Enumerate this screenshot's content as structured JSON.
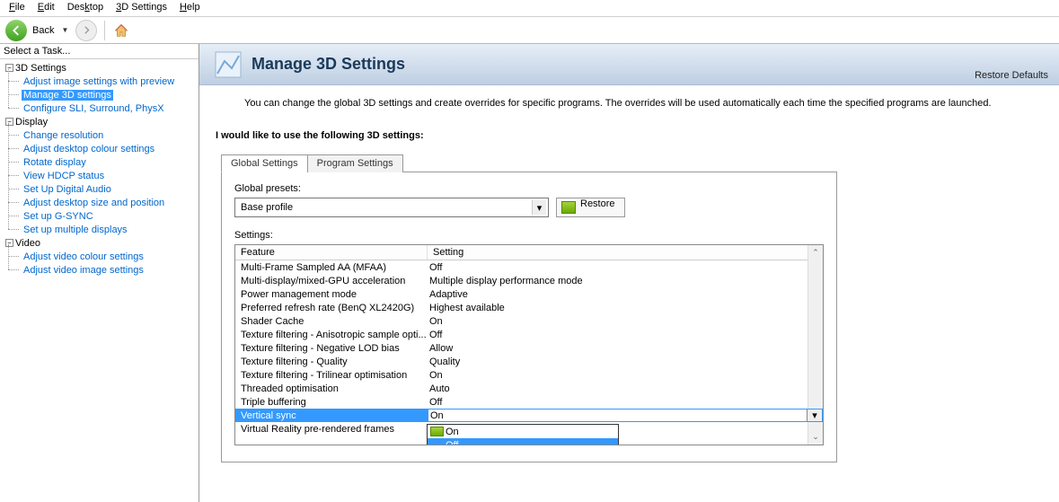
{
  "menubar": {
    "items": [
      "File",
      "Edit",
      "Desktop",
      "3D Settings",
      "Help"
    ]
  },
  "toolbar": {
    "back": "Back"
  },
  "sidebar": {
    "header": "Select a Task...",
    "groups": [
      {
        "label": "3D Settings",
        "items": [
          {
            "label": "Adjust image settings with preview",
            "selected": false
          },
          {
            "label": "Manage 3D settings",
            "selected": true
          },
          {
            "label": "Configure SLI, Surround, PhysX",
            "selected": false
          }
        ]
      },
      {
        "label": "Display",
        "items": [
          {
            "label": "Change resolution"
          },
          {
            "label": "Adjust desktop colour settings"
          },
          {
            "label": "Rotate display"
          },
          {
            "label": "View HDCP status"
          },
          {
            "label": "Set Up Digital Audio"
          },
          {
            "label": "Adjust desktop size and position"
          },
          {
            "label": "Set up G-SYNC"
          },
          {
            "label": "Set up multiple displays"
          }
        ]
      },
      {
        "label": "Video",
        "items": [
          {
            "label": "Adjust video colour settings"
          },
          {
            "label": "Adjust video image settings"
          }
        ]
      }
    ]
  },
  "main": {
    "title": "Manage 3D Settings",
    "restore_defaults": "Restore Defaults",
    "description": "You can change the global 3D settings and create overrides for specific programs. The overrides will be used automatically each time the specified programs are launched.",
    "section_label": "I would like to use the following 3D settings:",
    "tabs": [
      {
        "label": "Global Settings",
        "active": true
      },
      {
        "label": "Program Settings",
        "active": false
      }
    ],
    "global_presets_label": "Global presets:",
    "global_presets_value": "Base profile",
    "restore_button": "Restore",
    "settings_label": "Settings:",
    "columns": {
      "feature": "Feature",
      "setting": "Setting"
    },
    "rows": [
      {
        "feature": "Multi-Frame Sampled AA (MFAA)",
        "setting": "Off"
      },
      {
        "feature": "Multi-display/mixed-GPU acceleration",
        "setting": "Multiple display performance mode"
      },
      {
        "feature": "Power management mode",
        "setting": "Adaptive"
      },
      {
        "feature": "Preferred refresh rate (BenQ XL2420G)",
        "setting": "Highest available"
      },
      {
        "feature": "Shader Cache",
        "setting": "On"
      },
      {
        "feature": "Texture filtering - Anisotropic sample opti...",
        "setting": "Off"
      },
      {
        "feature": "Texture filtering - Negative LOD bias",
        "setting": "Allow"
      },
      {
        "feature": "Texture filtering - Quality",
        "setting": "Quality"
      },
      {
        "feature": "Texture filtering - Trilinear optimisation",
        "setting": "On"
      },
      {
        "feature": "Threaded optimisation",
        "setting": "Auto"
      },
      {
        "feature": "Triple buffering",
        "setting": "Off"
      },
      {
        "feature": "Vertical sync",
        "setting": "On",
        "selected": true
      },
      {
        "feature": "Virtual Reality pre-rendered frames",
        "setting": ""
      }
    ],
    "dropdown": {
      "options": [
        {
          "label": "On",
          "icon": true
        },
        {
          "label": "Off",
          "highlighted": true
        }
      ]
    }
  }
}
